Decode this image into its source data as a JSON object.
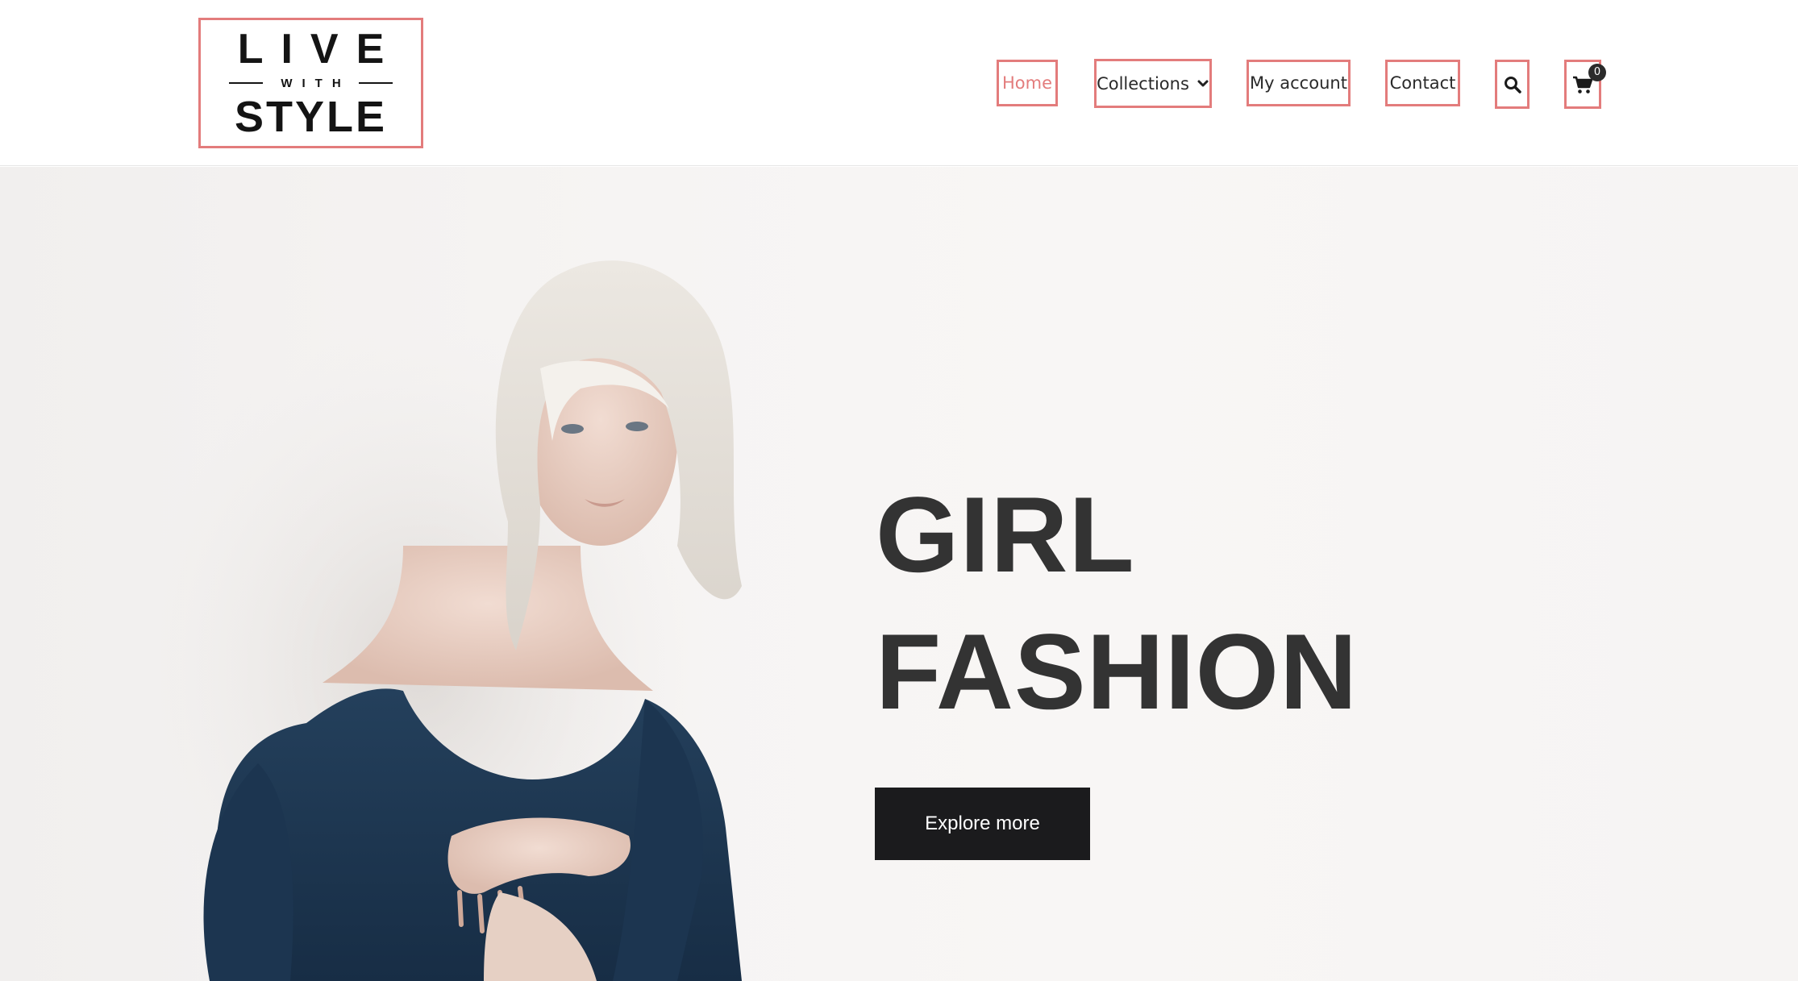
{
  "brand": {
    "logo_top": "LIVE",
    "logo_middle": "WITH",
    "logo_bottom": "STYLE"
  },
  "nav": {
    "home": "Home",
    "collections": "Collections",
    "my_account": "My account",
    "contact": "Contact",
    "search_icon": "search-icon",
    "cart_icon": "cart-icon",
    "cart_count": "0",
    "chevron_icon": "chevron-down-icon"
  },
  "hero": {
    "title_line1": "GIRL",
    "title_line2": "FASHION",
    "cta_label": "Explore more"
  },
  "colors": {
    "accent": "#e37c7c",
    "button_bg": "#1b1b1d",
    "title_text": "#333333",
    "hero_bg": "#f6f4f3"
  }
}
